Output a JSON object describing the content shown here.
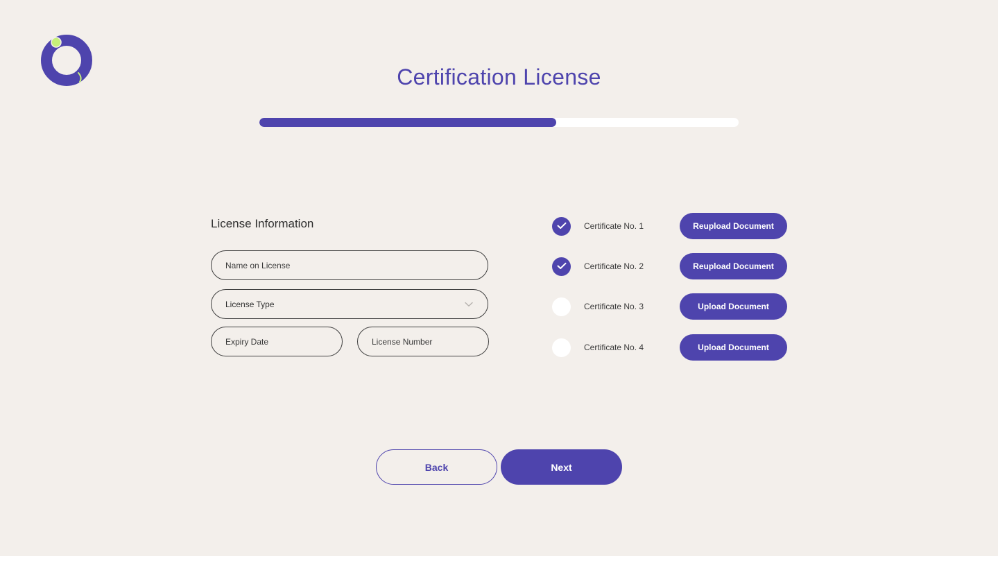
{
  "header": {
    "title": "Certification License",
    "progress": 0.62
  },
  "colors": {
    "accent": "#4e44ad",
    "logo_dot": "#c6f07a",
    "background": "#f3efeb"
  },
  "license_form": {
    "heading": "License Information",
    "name_placeholder": "Name on License",
    "type_value": "License Type",
    "expiry_placeholder": "Expiry Date",
    "number_placeholder": "License Number"
  },
  "certificates": [
    {
      "label": "Certificate No. 1",
      "checked": true,
      "button": "Reupload Document"
    },
    {
      "label": "Certificate No. 2",
      "checked": true,
      "button": "Reupload Document"
    },
    {
      "label": "Certificate No. 3",
      "checked": false,
      "button": "Upload Document"
    },
    {
      "label": "Certificate No. 4",
      "checked": false,
      "button": "Upload Document"
    }
  ],
  "footer": {
    "back_label": "Back",
    "next_label": "Next"
  },
  "icons": {
    "logo": "ring-logo-icon",
    "select": "chevron-down-icon",
    "check": "checkmark-icon"
  }
}
